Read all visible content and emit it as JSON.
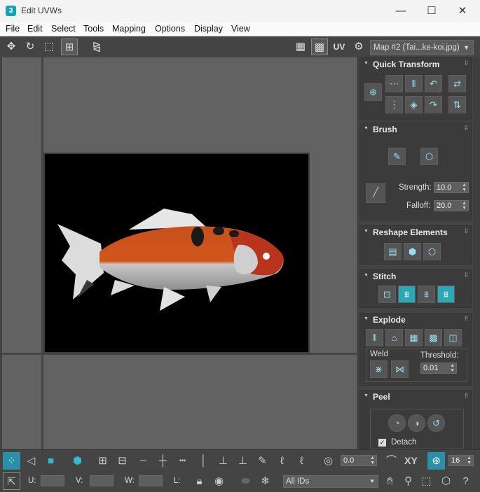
{
  "window": {
    "app_icon_text": "3",
    "title": "Edit UVWs",
    "minimize": "—",
    "maximize": "☐",
    "close": "✕"
  },
  "menu": [
    "File",
    "Edit",
    "Select",
    "Tools",
    "Mapping",
    "Options",
    "Display",
    "View"
  ],
  "toolbar": {
    "uv_label": "UV",
    "map_selector": "Map #2 (Tai...ke-koi.jpg)"
  },
  "panel": {
    "quick_transform": {
      "title": "Quick Transform"
    },
    "brush": {
      "title": "Brush",
      "strength_label": "Strength:",
      "strength_value": "10.0",
      "falloff_label": "Falloff:",
      "falloff_value": "20.0"
    },
    "reshape": {
      "title": "Reshape Elements"
    },
    "stitch": {
      "title": "Stitch"
    },
    "explode": {
      "title": "Explode",
      "weld_label": "Weld",
      "threshold_label": "Threshold:",
      "threshold_value": "0.01"
    },
    "peel": {
      "title": "Peel",
      "detach_label": "Detach",
      "detach_checked": true
    }
  },
  "bottom": {
    "rotation_value": "0.0",
    "xy_label": "XY",
    "grid_value": "16",
    "u_label": "U:",
    "v_label": "V:",
    "w_label": "W:",
    "l_label": "L:",
    "ids_selector": "All IDs"
  },
  "colors": {
    "accent": "#2aa8b6",
    "background": "#444444",
    "viewport": "#626262"
  }
}
